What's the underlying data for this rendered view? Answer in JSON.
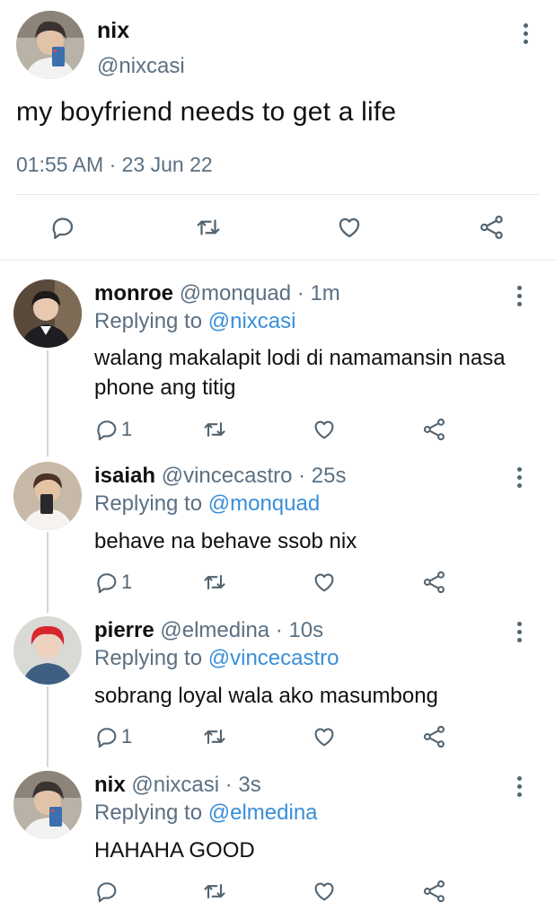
{
  "main_tweet": {
    "name": "nix",
    "handle": "@nixcasi",
    "text": "my boyfriend needs to get a life",
    "timestamp": "01:55 AM · 23 Jun 22",
    "actions": [
      "reply-icon",
      "retweet-icon",
      "like-icon",
      "share-icon"
    ]
  },
  "replies": [
    {
      "name": "monroe",
      "handle_time": "@monquad · 1m",
      "replying_prefix": "Replying to",
      "replying_to": "@nixcasi",
      "text": "walang makalapit lodi di namamansin nasa phone ang titig",
      "reply_count": "1"
    },
    {
      "name": "isaiah",
      "handle_time": "@vincecastro · 25s",
      "replying_prefix": "Replying to",
      "replying_to": "@monquad",
      "text": "behave na behave ssob nix",
      "reply_count": "1"
    },
    {
      "name": "pierre",
      "handle_time": "@elmedina · 10s",
      "replying_prefix": "Replying to",
      "replying_to": "@vincecastro",
      "text": "sobrang loyal wala ako masumbong",
      "reply_count": "1"
    },
    {
      "name": "nix",
      "handle_time": "@nixcasi · 3s",
      "replying_prefix": "Replying to",
      "replying_to": "@elmedina",
      "text": "HAHAHA GOOD",
      "reply_count": ""
    }
  ],
  "colors": {
    "accent": "#3a8fd9",
    "secondary_text": "#5b7083",
    "divider": "#e1e8ed",
    "thread_line": "#cfd9de"
  }
}
